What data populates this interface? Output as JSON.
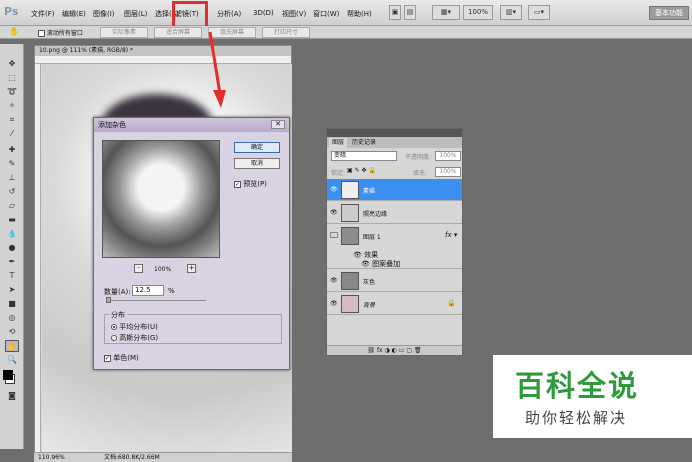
{
  "menubar": {
    "logo": "Ps",
    "items": [
      "文件(F)",
      "编辑(E)",
      "图像(I)",
      "图层(L)",
      "选择(S)",
      "滤镜(T)",
      "分析(A)",
      "3D(D)",
      "视图(V)",
      "窗口(W)",
      "帮助(H)"
    ],
    "zoom": "100%",
    "workspace": "基本功能"
  },
  "options": {
    "scroll_all": "滚动所有窗口",
    "actual_pixels": "实际像素",
    "fit_screen": "适合屏幕",
    "fill_screen": "填充屏幕",
    "print_size": "打印尺寸"
  },
  "document": {
    "title": "10.png @ 111% (素描, RGB/8) *",
    "zoom": "110.96%",
    "doc_info": "文档:680.8K/2.66M"
  },
  "dialog": {
    "title": "添加杂色",
    "ok": "确定",
    "cancel": "取消",
    "preview": "预览(P)",
    "zoom": "100%",
    "amount_label": "数量(A):",
    "amount": "12.5",
    "unit": "%",
    "distribution": "分布",
    "uniform": "平均分布(U)",
    "gaussian": "高斯分布(G)",
    "mono": "单色(M)"
  },
  "layers_panel": {
    "tabs": [
      "图层",
      "历史记录"
    ],
    "blend": "变暗",
    "opacity_label": "不透明度:",
    "opacity": "100%",
    "lock_label": "锁定:",
    "fill_label": "填充:",
    "fill": "100%",
    "layers": [
      {
        "name": "素描"
      },
      {
        "name": "照亮边缘"
      },
      {
        "name": "图层 1"
      },
      {
        "name": "效果"
      },
      {
        "name": "图案叠加"
      },
      {
        "name": "灰色"
      },
      {
        "name": "背景"
      }
    ]
  },
  "watermark": {
    "title": "百科全说",
    "subtitle": "助你轻松解决"
  }
}
